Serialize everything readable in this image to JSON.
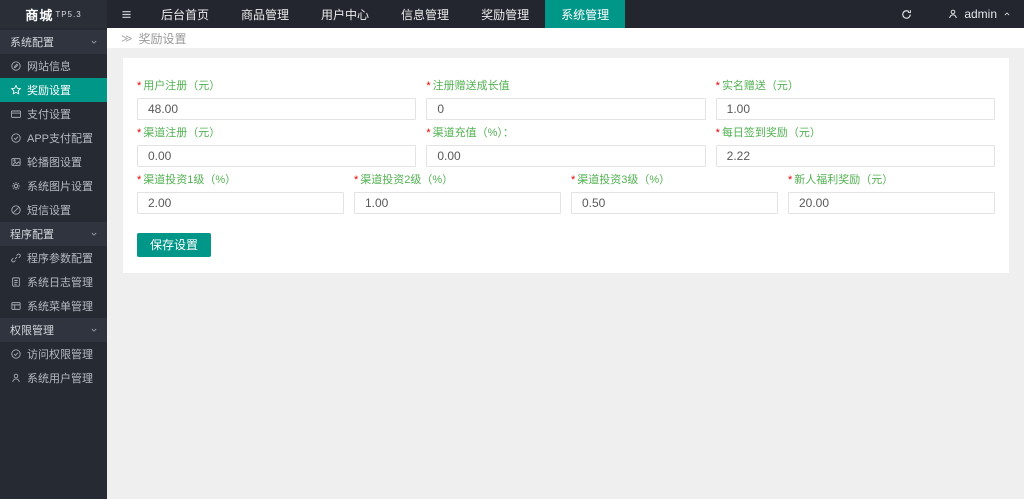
{
  "app": {
    "brand": "商城",
    "brand_version": "TP5.3"
  },
  "topnav": {
    "items": [
      "后台首页",
      "商品管理",
      "用户中心",
      "信息管理",
      "奖励管理",
      "系统管理"
    ],
    "active": "系统管理",
    "user": "admin"
  },
  "sidebar": {
    "sections": [
      {
        "label": "系统配置",
        "items": [
          {
            "icon": "edit-circle-icon",
            "label": "网站信息"
          },
          {
            "icon": "star-icon",
            "label": "奖励设置",
            "active": true
          },
          {
            "icon": "card-icon",
            "label": "支付设置"
          },
          {
            "icon": "check-circle-icon",
            "label": "APP支付配置"
          },
          {
            "icon": "image-icon",
            "label": "轮播图设置"
          },
          {
            "icon": "gear-icon",
            "label": "系统图片设置"
          },
          {
            "icon": "slash-circle-icon",
            "label": "短信设置"
          }
        ]
      },
      {
        "label": "程序配置",
        "items": [
          {
            "icon": "link-icon",
            "label": "程序参数配置"
          },
          {
            "icon": "log-icon",
            "label": "系统日志管理"
          },
          {
            "icon": "menu-grid-icon",
            "label": "系统菜单管理"
          }
        ]
      },
      {
        "label": "权限管理",
        "items": [
          {
            "icon": "check-circle-icon",
            "label": "访问权限管理"
          },
          {
            "icon": "user-icon",
            "label": "系统用户管理"
          }
        ]
      }
    ]
  },
  "breadcrumb": {
    "symbol": "≫",
    "label": "奖励设置"
  },
  "form": {
    "required_marker": "*",
    "rows": [
      {
        "fields": [
          {
            "label": "用户注册（元）",
            "value": "48.00"
          },
          {
            "label": "注册赠送成长值",
            "value": "0"
          },
          {
            "label": "实名赠送（元）",
            "value": "1.00"
          }
        ]
      },
      {
        "fields": [
          {
            "label": "渠道注册（元）",
            "value": "0.00"
          },
          {
            "label": "渠道充值（%）：",
            "value": "0.00"
          },
          {
            "label": "每日签到奖励（元）",
            "value": "2.22"
          }
        ]
      },
      {
        "fields": [
          {
            "label": "渠道投资1级（%）",
            "value": "2.00"
          },
          {
            "label": "渠道投资2级（%）",
            "value": "1.00"
          },
          {
            "label": "渠道投资3级（%）",
            "value": "0.50"
          },
          {
            "label": "新人福利奖励（元）",
            "value": "20.00"
          }
        ]
      }
    ],
    "save_label": "保存设置"
  },
  "colors": {
    "accent": "#009688",
    "topbar_bg": "#23262e",
    "sidebar_bg": "#262a33",
    "label_green": "#52b152",
    "required_red": "#e60000",
    "content_bg": "#efefef"
  }
}
